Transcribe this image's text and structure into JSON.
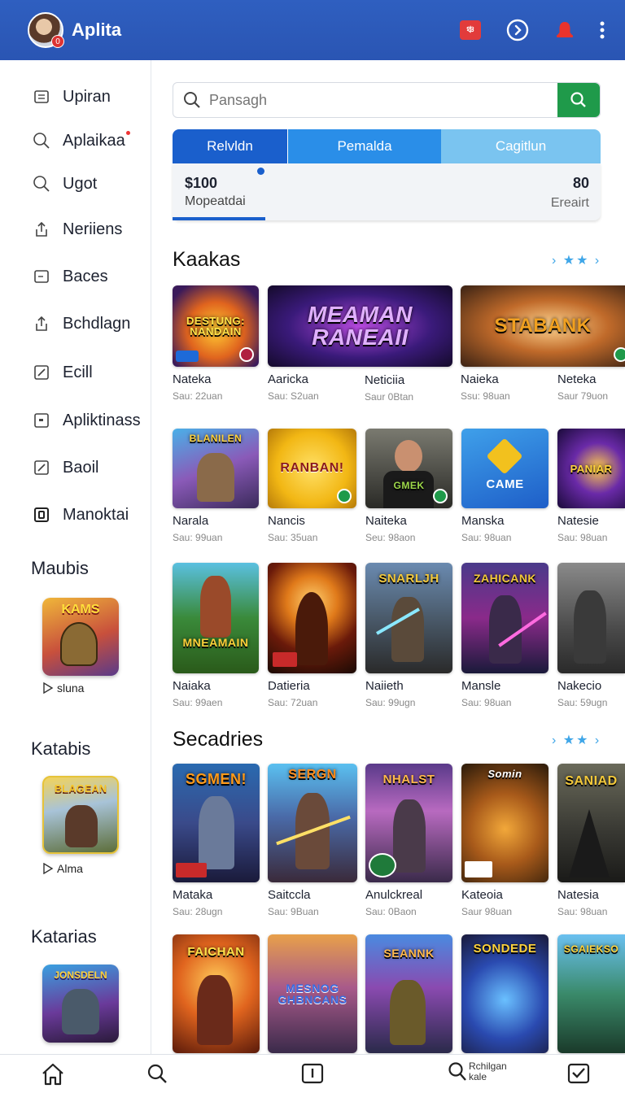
{
  "app": {
    "title": "Aplita",
    "avatar_badge": "0",
    "notif_badge": "ঞ্চ"
  },
  "sidebar": {
    "items": [
      {
        "label": "Upiran",
        "icon": "calendar-icon"
      },
      {
        "label": "Aplaikaa",
        "icon": "search-icon"
      },
      {
        "label": "Ugot",
        "icon": "search-icon"
      },
      {
        "label": "Neriiens",
        "icon": "share-icon"
      },
      {
        "label": "Baces",
        "icon": "square-icon"
      },
      {
        "label": "Bchdlagn",
        "icon": "share-icon"
      },
      {
        "label": "Ecill",
        "icon": "edit-icon"
      },
      {
        "label": "Apliktinass",
        "icon": "square-icon"
      },
      {
        "label": "Baoil",
        "icon": "edit-icon"
      },
      {
        "label": "Manoktai",
        "icon": "box-icon"
      }
    ],
    "sections": [
      {
        "title": "Maubis",
        "thumb_text": "KAMS",
        "caption": "sluna"
      },
      {
        "title": "Katabis",
        "thumb_text": "BLAGEAN",
        "caption": "Alma"
      },
      {
        "title": "Katarias",
        "thumb_text": "JONSDELN",
        "caption": ""
      }
    ]
  },
  "search": {
    "placeholder": "Pansagh"
  },
  "tabs": [
    "Relvldn",
    "Pemalda",
    "Cagitlun"
  ],
  "stats": {
    "value_left": "$100",
    "label_left": "Mopeatdai",
    "value_right": "80",
    "label_right": "Ereairt"
  },
  "section1": {
    "title": "Kaakas",
    "more": "› ★★ ›",
    "rows": [
      [
        {
          "name": "Nateka",
          "sub": "Sau: 22uan",
          "art": "DESTUNG: NANDAIN"
        },
        {
          "name": "Aaricka",
          "sub": "Sau: S2uan",
          "art": "MEAMAN RANEAII"
        },
        {
          "name": "Neticiia",
          "sub": "Saur 0Btan",
          "art": ""
        },
        {
          "name": "Naieka",
          "sub": "Ssu: 98uan",
          "art": "STABANK"
        },
        {
          "name": "Neteka",
          "sub": "Saur 79uon",
          "art": ""
        }
      ],
      [
        {
          "name": "Narala",
          "sub": "Sau: 99uan",
          "art": "BLANILEN"
        },
        {
          "name": "Nancis",
          "sub": "Sau: 35uan",
          "art": "RANBAN!"
        },
        {
          "name": "Naiteka",
          "sub": "Seu: 98aon",
          "art": "GMEK"
        },
        {
          "name": "Manska",
          "sub": "Sau: 98uan",
          "art": "CAME"
        },
        {
          "name": "Natesie",
          "sub": "Sau: 98uan",
          "art": "PANIAR"
        }
      ],
      [
        {
          "name": "Naiaka",
          "sub": "Sau: 99aen",
          "art": "MNEAMAIN"
        },
        {
          "name": "Datieria",
          "sub": "Sau: 72uan",
          "art": ""
        },
        {
          "name": "Naiieth",
          "sub": "Sau: 99ugn",
          "art": "SNARLJH"
        },
        {
          "name": "Mansle",
          "sub": "Sau: 98uan",
          "art": "ZAHICANK"
        },
        {
          "name": "Nakecio",
          "sub": "Sau: 59ugn",
          "art": ""
        }
      ]
    ]
  },
  "section2": {
    "title": "Secadries",
    "more": "› ★★ ›",
    "rows": [
      [
        {
          "name": "Mataka",
          "sub": "Sau: 28ugn",
          "art": "SGMEN!"
        },
        {
          "name": "Saitccla",
          "sub": "Sau: 9Buan",
          "art": "SERGN"
        },
        {
          "name": "Anulckreal",
          "sub": "Sau: 0Baon",
          "art": "NHALST"
        },
        {
          "name": "Kateoia",
          "sub": "Saur 98uan",
          "art": "Somin"
        },
        {
          "name": "Natesia",
          "sub": "Sau: 98uan",
          "art": "SANIAD"
        }
      ],
      [
        {
          "name": "",
          "sub": "",
          "art": "FAICHAN"
        },
        {
          "name": "",
          "sub": "",
          "art": "MESNOG GHBNCANS"
        },
        {
          "name": "",
          "sub": "",
          "art": "SEANNK"
        },
        {
          "name": "",
          "sub": "",
          "art": "SONDEDE"
        },
        {
          "name": "",
          "sub": "",
          "art": "SGAIEKSO"
        }
      ]
    ]
  },
  "bottom_nav": {
    "items": [
      "home-icon",
      "search-icon",
      "info-icon",
      "search-icon",
      "checkbox-icon"
    ],
    "label_line1": "Rchilgan",
    "label_line2": "kale"
  }
}
